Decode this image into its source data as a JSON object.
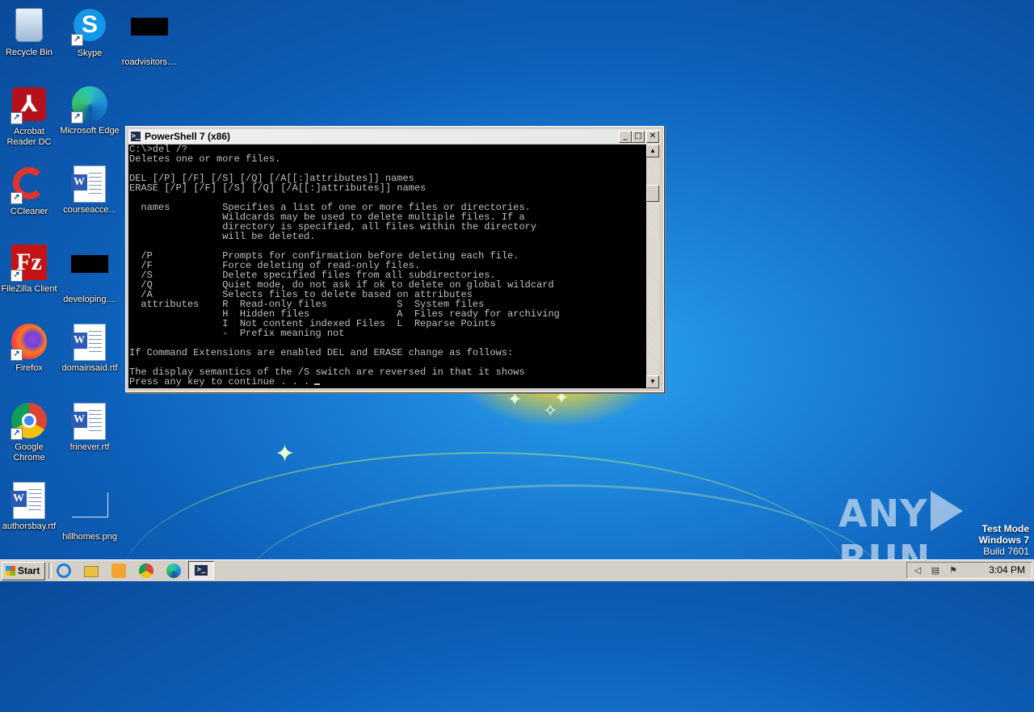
{
  "desktop": {
    "icons": [
      {
        "label": "Recycle Bin",
        "icon": "recycle-bin-icon"
      },
      {
        "label": "Skype",
        "icon": "skype-icon"
      },
      {
        "label": "roadvisitors....",
        "icon": "blank-file-icon"
      },
      {
        "label": "Acrobat Reader DC",
        "icon": "acrobat-icon"
      },
      {
        "label": "Microsoft Edge",
        "icon": "edge-icon"
      },
      {
        "label": "CCleaner",
        "icon": "ccleaner-icon"
      },
      {
        "label": "courseacce...",
        "icon": "word-doc-icon"
      },
      {
        "label": "FileZilla Client",
        "icon": "filezilla-icon"
      },
      {
        "label": "developing....",
        "icon": "blank-file-icon"
      },
      {
        "label": "Firefox",
        "icon": "firefox-icon"
      },
      {
        "label": "domainsaid.rtf",
        "icon": "word-doc-icon"
      },
      {
        "label": "Google Chrome",
        "icon": "chrome-icon"
      },
      {
        "label": "frinever.rtf",
        "icon": "word-doc-icon"
      },
      {
        "label": "authorsbay.rtf",
        "icon": "word-doc-icon"
      },
      {
        "label": "hillhomes.png",
        "icon": "image-file-icon"
      }
    ]
  },
  "window": {
    "title": "PowerShell 7 (x86)",
    "icon": "powershell-icon",
    "buttons": {
      "minimize": "_",
      "maximize": "□",
      "close": "✕"
    },
    "console_text": "C:\\>del /?\nDeletes one or more files.\n\nDEL [/P] [/F] [/S] [/Q] [/A[[:]attributes]] names\nERASE [/P] [/F] [/S] [/Q] [/A[[:]attributes]] names\n\n  names         Specifies a list of one or more files or directories.\n                Wildcards may be used to delete multiple files. If a\n                directory is specified, all files within the directory\n                will be deleted.\n\n  /P            Prompts for confirmation before deleting each file.\n  /F            Force deleting of read-only files.\n  /S            Delete specified files from all subdirectories.\n  /Q            Quiet mode, do not ask if ok to delete on global wildcard\n  /A            Selects files to delete based on attributes\n  attributes    R  Read-only files            S  System files\n                H  Hidden files               A  Files ready for archiving\n                I  Not content indexed Files  L  Reparse Points\n                -  Prefix meaning not\n\nIf Command Extensions are enabled DEL and ERASE change as follows:\n\nThe display semantics of the /S switch are reversed in that it shows",
    "prompt_line": "Press any key to continue . . ."
  },
  "watermark": {
    "left": "ANY",
    "right": "RUN"
  },
  "os_info": {
    "line1": "Test Mode",
    "line2": "Windows 7",
    "line3": "Build 7601"
  },
  "taskbar": {
    "start_label": "Start",
    "clock": "3:04 PM",
    "tray_icons": [
      "speaker-icon",
      "network-icon",
      "flag-icon",
      "shield-icon"
    ]
  },
  "colors": {
    "desktop": "#1a7fd6",
    "console_bg": "#000000",
    "console_fg": "#c0c0c0",
    "chrome": "#d4d0c8"
  }
}
